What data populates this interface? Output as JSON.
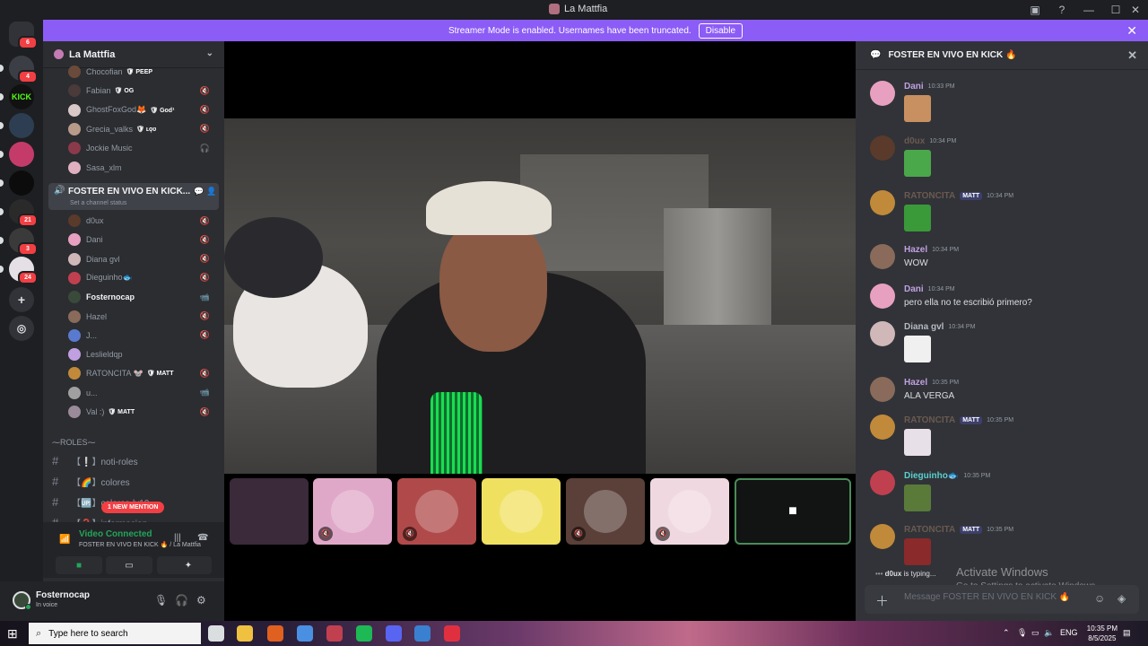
{
  "window": {
    "title": "La Mattfia"
  },
  "banner": {
    "text": "Streamer Mode is enabled. Usernames have been truncated.",
    "disable_label": "Disable"
  },
  "rail": {
    "servers": [
      {
        "name": "discord-home",
        "label": "",
        "badge": "6",
        "color": "#313338"
      },
      {
        "name": "server-1",
        "label": "",
        "badge": "4",
        "color": "#3c3e46"
      },
      {
        "name": "server-kick",
        "label": "KICK",
        "badge": "",
        "color": "#111111"
      },
      {
        "name": "server-3",
        "label": "",
        "badge": "",
        "color": "#2d3e52"
      },
      {
        "name": "server-4",
        "label": "",
        "badge": "",
        "color": "#c43b6a"
      },
      {
        "name": "server-5",
        "label": "",
        "badge": "",
        "color": "#0c0c0c"
      },
      {
        "name": "server-6",
        "label": "",
        "badge": "21",
        "color": "#2a2a2a"
      },
      {
        "name": "server-7",
        "label": "",
        "badge": "3",
        "color": "#3a3a3a"
      },
      {
        "name": "server-8",
        "label": "",
        "badge": "24",
        "color": "#e4e0e6"
      }
    ]
  },
  "sidebar": {
    "guild_name": "La Mattfia",
    "top_users": [
      {
        "name": "Chocofian",
        "tag": "PEEP",
        "status": "",
        "color": "#6a4a3a"
      },
      {
        "name": "Fabian",
        "tag": "OG",
        "status": "🔇",
        "color": "#4a3a3a"
      },
      {
        "name": "GhostFoxGod🦊",
        "tag": "God¹",
        "status": "🔇",
        "color": "#d8c8c8"
      },
      {
        "name": "Grecia_valks",
        "tag": "ʟǫʋ",
        "status": "🔇",
        "color": "#b89a8a"
      },
      {
        "name": "Jockie Music",
        "tag": "",
        "status": "🎧",
        "color": "#8a3a4a"
      },
      {
        "name": "Sasa_xlm",
        "tag": "",
        "status": "",
        "color": "#e0b0c0"
      }
    ],
    "voice_channel": {
      "name": "FOSTER EN VIVO EN KICK...",
      "status_placeholder": "Set a channel status"
    },
    "voice_users": [
      {
        "name": "d0ux",
        "tag": "",
        "status": "🔇",
        "color": "#5a3a2a",
        "live": false
      },
      {
        "name": "Dani",
        "tag": "",
        "status": "🔇",
        "color": "#e8a0c0",
        "live": false
      },
      {
        "name": "Diana gvl",
        "tag": "",
        "status": "🔇",
        "color": "#d0b8b8",
        "live": false
      },
      {
        "name": "Dieguinho🐟",
        "tag": "",
        "status": "🔇",
        "color": "#c04050",
        "live": false
      },
      {
        "name": "Fosternocap",
        "tag": "",
        "status": "📹",
        "color": "#3a4a3a",
        "live": true
      },
      {
        "name": "Hazel",
        "tag": "",
        "status": "🔇",
        "color": "#8a6a5a",
        "live": false
      },
      {
        "name": "J...",
        "tag": "",
        "status": "🔇",
        "color": "#5a7ad0",
        "live": false
      },
      {
        "name": "Leslieldqp",
        "tag": "",
        "status": "",
        "color": "#c0a0e0",
        "live": false
      },
      {
        "name": "RATONCITA 🐭",
        "tag": "MATT",
        "status": "🔇",
        "color": "#c08a3a",
        "live": false
      },
      {
        "name": "u...",
        "tag": "",
        "status": "📹",
        "color": "#a0a0a0",
        "live": false
      },
      {
        "name": "Val :)",
        "tag": "MATT",
        "status": "🔇",
        "color": "#9a8a9a",
        "live": false
      }
    ],
    "roles_header": "⁓ROLES⁓",
    "text_channels": [
      {
        "name": "【❕】noti-roles"
      },
      {
        "name": "【🌈】colores"
      },
      {
        "name": "【🆙】colores-lv10"
      },
      {
        "name": "【❓】informacion"
      }
    ],
    "new_mention": "1 NEW MENTION"
  },
  "voice_panel": {
    "status": "Video Connected",
    "channel": "FOSTER EN VIVO EN KICK 🔥 / La Mattfia"
  },
  "user_panel": {
    "name": "Fosternocap",
    "status": "In voice"
  },
  "tiles": [
    {
      "name": "tile-fosternocap",
      "color": "#3a2a3a",
      "muted": false
    },
    {
      "name": "tile-dani",
      "color": "#e0a8c8",
      "muted": true
    },
    {
      "name": "tile-dieguinho",
      "color": "#b04a4a",
      "muted": true
    },
    {
      "name": "tile-j",
      "color": "#f0e060",
      "muted": false
    },
    {
      "name": "tile-diana",
      "color": "#5a4038",
      "muted": true
    },
    {
      "name": "tile-leslie",
      "color": "#f0d8e0",
      "muted": true
    }
  ],
  "chat": {
    "title": "FOSTER EN VIVO EN KICK 🔥",
    "messages": [
      {
        "author": "Dani",
        "tag": "",
        "time": "10:33 PM",
        "text": "",
        "emoji": true,
        "name_color": "#c0a0e0",
        "avatar": "#e8a0c0",
        "emoji_color": "#c89060"
      },
      {
        "author": "d0ux",
        "tag": "",
        "time": "10:34 PM",
        "text": "",
        "emoji": true,
        "name_color": "#6a5a50",
        "avatar": "#5a3a2a",
        "emoji_color": "#4aa84a"
      },
      {
        "author": "RATONCITA",
        "tag": "MATT",
        "time": "10:34 PM",
        "text": "",
        "emoji": true,
        "name_color": "#6a5a50",
        "avatar": "#c08a3a",
        "emoji_color": "#3a9a3a"
      },
      {
        "author": "Hazel",
        "tag": "",
        "time": "10:34 PM",
        "text": "WOW",
        "emoji": false,
        "name_color": "#c0a0e0",
        "avatar": "#8a6a5a",
        "emoji_color": ""
      },
      {
        "author": "Dani",
        "tag": "",
        "time": "10:34 PM",
        "text": "pero ella no te escribió primero?",
        "emoji": false,
        "name_color": "#c0a0e0",
        "avatar": "#e8a0c0",
        "emoji_color": ""
      },
      {
        "author": "Diana gvl",
        "tag": "",
        "time": "10:34 PM",
        "text": "",
        "emoji": true,
        "name_color": "#b5bac1",
        "avatar": "#d0b8b8",
        "emoji_color": "#f0f0f0"
      },
      {
        "author": "Hazel",
        "tag": "",
        "time": "10:35 PM",
        "text": "ALA VERGA",
        "emoji": false,
        "name_color": "#c0a0e0",
        "avatar": "#8a6a5a",
        "emoji_color": ""
      },
      {
        "author": "RATONCITA",
        "tag": "MATT",
        "time": "10:35 PM",
        "text": "",
        "emoji": true,
        "name_color": "#6a5a50",
        "avatar": "#c08a3a",
        "emoji_color": "#e8e0e8"
      },
      {
        "author": "Dieguinho🐟",
        "tag": "",
        "time": "10:35 PM",
        "text": "",
        "emoji": true,
        "name_color": "#5ad0d0",
        "avatar": "#c04050",
        "emoji_color": "#5a7a3a"
      },
      {
        "author": "RATONCITA",
        "tag": "MATT",
        "time": "10:35 PM",
        "text": "",
        "emoji": true,
        "name_color": "#6a5a50",
        "avatar": "#c08a3a",
        "emoji_color": "#8a2a2a"
      }
    ],
    "typing_user": "d0ux",
    "typing_suffix": " is typing...",
    "input_placeholder": "Message FOSTER EN VIVO EN KICK 🔥",
    "watermark_title": "Activate Windows",
    "watermark_sub": "Go to Settings to activate Windows."
  },
  "taskbar": {
    "search_placeholder": "Type here to search",
    "language": "ENG",
    "time": "10:35 PM",
    "date": "8/5/2025",
    "apps": [
      {
        "name": "task-view",
        "color": "#dbdee1"
      },
      {
        "name": "file-explorer",
        "color": "#f0c040"
      },
      {
        "name": "firefox",
        "color": "#e06020"
      },
      {
        "name": "chrome",
        "color": "#4a90e2"
      },
      {
        "name": "app-4",
        "color": "#c04050"
      },
      {
        "name": "spotify",
        "color": "#1db954"
      },
      {
        "name": "discord",
        "color": "#5865f2"
      },
      {
        "name": "chrome-2",
        "color": "#3a80d0"
      },
      {
        "name": "app-8",
        "color": "#e03040"
      }
    ]
  }
}
